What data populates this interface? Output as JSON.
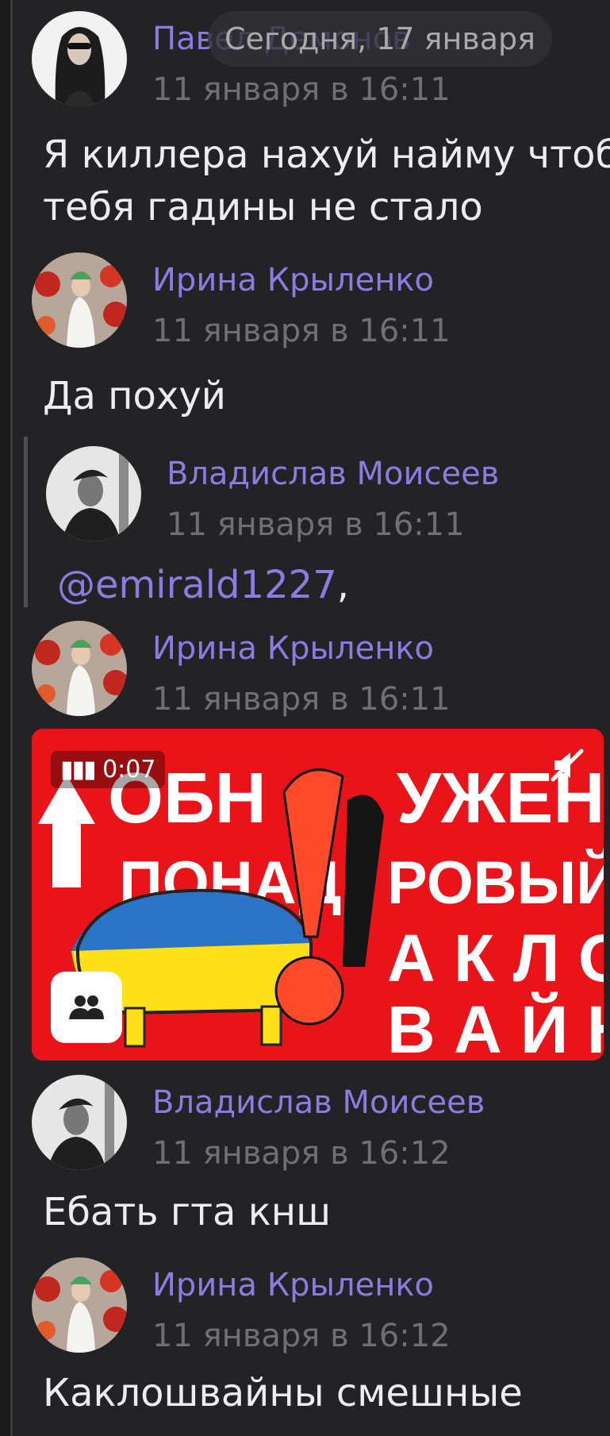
{
  "date_pill": "Сегодня, 17 января",
  "comments": [
    {
      "author": "Павел Демонов",
      "time": "11 января в 16:11",
      "text": "Я киллера нахуй найму чтоб тебя гадины не стало"
    },
    {
      "author": "Ирина Крыленко",
      "time": "11 января в 16:11",
      "text": "Да похуй"
    },
    {
      "author": "Владислав Моисеев",
      "time": "11 января в 16:11",
      "mention": "@emirald1227",
      "text": ","
    },
    {
      "author": "Ирина Крыленко",
      "time": "11 января в 16:11"
    },
    {
      "author": "Владислав Моисеев",
      "time": "11 января в 16:12",
      "text": "Ебать гта кнш"
    },
    {
      "author": "Ирина Крыленко",
      "time": "11 января в 16:12",
      "text": "Каклошвайны смешные"
    }
  ],
  "video": {
    "duration": "0:07",
    "lines": [
      "ОБНАРУЖЕН",
      "ПОНАДКОРОВЫЙ",
      "АКЛО",
      "ВАЙН"
    ]
  },
  "colors": {
    "accent": "#8c7be0",
    "background": "#232325",
    "video_red": "#e8141a"
  },
  "icons": [
    "video-play-icon",
    "muted-icon",
    "group-icon"
  ]
}
